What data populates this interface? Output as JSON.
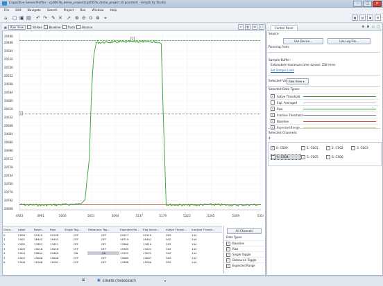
{
  "window": {
    "title": "Capacitive Sense Profiler - cpd007b_demo_project/cpd007b_demo_project.slcpcontent - Simplicity Studio",
    "min": "–",
    "max": "□",
    "close": "✕"
  },
  "menu": [
    "File",
    "Edit",
    "Navigate",
    "Search",
    "Project",
    "Run",
    "Window",
    "Help"
  ],
  "toolbar": {
    "icons": [
      "home-icon",
      "new-icon",
      "save-icon",
      "print-icon",
      "undo-icon",
      "redo-icon",
      "zoom-in-icon",
      "zoom-out-icon",
      "zoom-fit-icon",
      "zoom-reset-icon"
    ]
  },
  "view_controls": {
    "view_select": "Raw View",
    "options": [
      "Strikes",
      "Baseline",
      "Trace",
      "Bounce"
    ]
  },
  "chart_data": {
    "type": "line",
    "ylim": [
      20810,
      20470
    ],
    "yticks": [
      20476,
      20488,
      20504,
      20520,
      20536,
      20552,
      20568,
      20584,
      20600,
      20616,
      20632,
      20648,
      20664,
      20680,
      20696,
      20712,
      20728,
      20744,
      20760,
      20776,
      20792,
      20808
    ],
    "yticks_labels": [
      "20486",
      "20488",
      "20504",
      "20520",
      "20536",
      "20552",
      "20568",
      "20584",
      "20600",
      "20616",
      "20632",
      "20648",
      "20664",
      "20680",
      "20696",
      "20712",
      "20728",
      "20744",
      "20760",
      "20776",
      "20792",
      "20808"
    ],
    "xlim": [
      4923,
      5354
    ],
    "xticks": [
      4923,
      4961,
      5000,
      5051,
      5094,
      5137,
      5179,
      5222,
      5265,
      5309,
      5354
    ],
    "markers": [
      "0",
      "0"
    ],
    "series": [
      {
        "name": "Active Threshold",
        "color": "#3c9c3c",
        "style": "dashed",
        "y": 20484
      },
      {
        "name": "Inactive Threshold",
        "color": "#888888",
        "style": "dotted",
        "y": 20624
      },
      {
        "name": "Baseline",
        "color": "#d94d3a",
        "style": "solid",
        "y": 20800
      },
      {
        "name": "Raw",
        "color": "#2ea12e",
        "style": "solid",
        "x": [
          4923,
          4961,
          5000,
          5030,
          5040,
          5042,
          5048,
          5051,
          5055,
          5060,
          5094,
          5137,
          5170,
          5176,
          5179,
          5185,
          5222,
          5265,
          5309,
          5354
        ],
        "y": [
          20800,
          20801,
          20800,
          20799,
          20790,
          20770,
          20710,
          20600,
          20520,
          20488,
          20487,
          20486,
          20487,
          20488,
          20600,
          20800,
          20801,
          20800,
          20801,
          20800
        ]
      }
    ]
  },
  "table": {
    "columns": [
      "Chan...",
      "Label",
      "Basel...",
      "Raw",
      "Single Tog...",
      "Debounce Tog...",
      "Expected Ra...",
      "Exp Avera...",
      "Active Thresh...",
      "Inactive Thresh..."
    ],
    "rows": [
      [
        "0",
        "CS00",
        "20129",
        "20128",
        "OFF",
        "OFF",
        "20417",
        "20119",
        "302",
        "144"
      ],
      [
        "1",
        "CS01",
        "16442",
        "16442",
        "OFF",
        "OFF",
        "16719",
        "16441",
        "302",
        "144"
      ],
      [
        "2",
        "CS02",
        "17622",
        "17611",
        "OFF",
        "OFF",
        "17860",
        "17610",
        "302",
        "144"
      ],
      [
        "3",
        "CS03",
        "15016",
        "15016",
        "OFF",
        "OFF",
        "15309",
        "15021",
        "302",
        "144"
      ],
      [
        "4",
        "CS04",
        "20804",
        "20489",
        "ON",
        "ON",
        "13192",
        "13025",
        "302",
        "144"
      ],
      [
        "5",
        "CS05",
        "13006",
        "13006",
        "OFF",
        "OFF",
        "13089",
        "13007",
        "302",
        "144"
      ],
      [
        "6",
        "CS06",
        "11006",
        "11001",
        "OFF",
        "OFF",
        "13468",
        "11000",
        "302",
        "144"
      ]
    ]
  },
  "side_panel": {
    "all_channels": "All Channels",
    "data_types_label": "Data Types:",
    "items": [
      "Baseline",
      "Raw",
      "Single Toggle",
      "Debounce Toggle",
      "Expected Range"
    ]
  },
  "control_panel": {
    "tab_title": "Control Panel",
    "source_label": "Source",
    "use_device": "Use Device...",
    "use_log": "Use Log File...",
    "running_from": "Running from:",
    "sample_buffer": "Sample Buffer:",
    "estimated": "Estimated maximum time stored: 158 mins",
    "set_limit": "Set Sample Limit",
    "selected_view_label": "Selected View:",
    "selected_view_value": "Raw View",
    "data_types_label": "Selected Data Types:",
    "data_types": [
      {
        "name": "Active Threshold",
        "checked": true,
        "color": "#3c9c3c"
      },
      {
        "name": "Exp. Averaged",
        "checked": false,
        "color": "#d4b4d8"
      },
      {
        "name": "Raw",
        "checked": true,
        "color": "#2ea12e"
      },
      {
        "name": "Inactive Threshold",
        "checked": true,
        "color": "#888888"
      },
      {
        "name": "Baseline",
        "checked": true,
        "color": "#d94d3a"
      },
      {
        "name": "Expected Range",
        "checked": true,
        "color": "#d8d36a"
      }
    ],
    "channels_label": "Selected Channels:",
    "channels_group": "4",
    "channels": [
      "0: CS00",
      "1: CS01",
      "2: CS02",
      "3: CS03",
      "4: CS04",
      "5: CS05",
      "6: CS06"
    ]
  },
  "status": {
    "device": "EFM8TB (T000003367)"
  }
}
